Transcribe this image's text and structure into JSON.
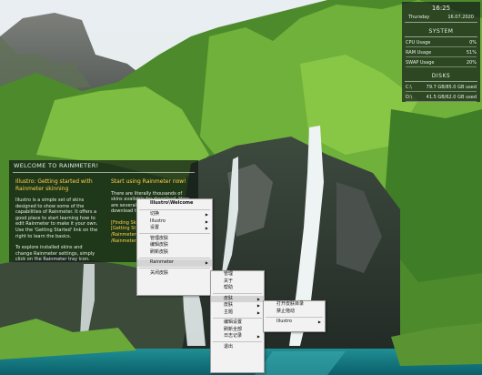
{
  "system_widget": {
    "time": "16:25",
    "day": "Thursday",
    "date": "16.07.2020",
    "system_title": "SYSTEM",
    "cpu_label": "CPU Usage",
    "cpu_value": "0%",
    "ram_label": "RAM Usage",
    "ram_value": "51%",
    "swap_label": "SWAP Usage",
    "swap_value": "20%",
    "disks_title": "DISKS",
    "disk_c_label": "C:\\",
    "disk_c_value": "79.7 GB/85.0 GB used",
    "disk_d_label": "D:\\",
    "disk_d_value": "41.5 GB/62.0 GB used"
  },
  "welcome_widget": {
    "title": "WELCOME TO RAINMETER!",
    "left_heading": "Illustro: Getting started with Rainmeter skinning",
    "left_p1": "Illustro is a simple set of skins designed to show some of the capabilities of Rainmeter. It offers a good place to start learning how to edit Rainmeter to make it your own. Use the 'Getting Started' link on the right to learn the basics.",
    "left_p2": "To explore installed skins and change Rainmeter settings, simply click on the Rainmeter tray icon.",
    "right_heading": "Start using Rainmeter now!",
    "right_p1": "There are literally thousands of skins available for download. Here are several good places for you to download them:",
    "right_link1": "[Finding Sk",
    "right_link2": "[Getting St",
    "right_link3": "/Rainmeter",
    "right_link4": "/Rainmeter"
  },
  "menu_main": {
    "header": "Illustro\\Welcome",
    "items": [
      "切换",
      "Illustro",
      "设置",
      "管理皮肤",
      "编辑皮肤",
      "刷新皮肤",
      "Rainmeter",
      "关闭皮肤"
    ]
  },
  "menu_rainmeter": {
    "items": [
      "管理",
      "关于",
      "帮助",
      "皮肤",
      "皮肤",
      "主题",
      "编辑设置",
      "刷新全部",
      "日志记录",
      "退出"
    ]
  },
  "menu_skins": {
    "items": [
      "打开皮肤目录",
      "禁止拖动",
      "Illustro"
    ]
  },
  "colors": {
    "accent_yellow": "#ffd24a",
    "menu_bg": "#f2f2f2",
    "menu_highlight": "#d4d4d4"
  }
}
